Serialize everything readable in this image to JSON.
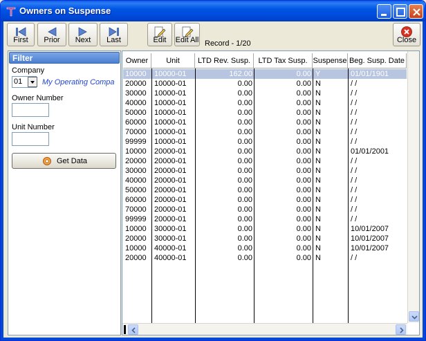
{
  "window": {
    "title": "Owners on Suspense"
  },
  "toolbar": {
    "first": "First",
    "prior": "Prior",
    "next": "Next",
    "last": "Last",
    "edit": "Edit",
    "edit_all": "Edit All",
    "close": "Close",
    "record": "Record - 1/20"
  },
  "filter": {
    "header": "Filter",
    "company_label": "Company",
    "company_value": "01",
    "company_name": "My Operating Compa",
    "owner_label": "Owner Number",
    "owner_value": "",
    "unit_label": "Unit Number",
    "unit_value": "",
    "get_data": "Get Data"
  },
  "grid": {
    "columns": [
      "Owner",
      "Unit",
      "LTD Rev. Susp.",
      "LTD Tax Susp.",
      "Suspense",
      "Beg. Susp. Date"
    ],
    "rows": [
      [
        "10000",
        "10000-01",
        "162.00",
        "0.00",
        "Y",
        "01/01/1901"
      ],
      [
        "20000",
        "10000-01",
        "0.00",
        "0.00",
        "N",
        "/ /"
      ],
      [
        "30000",
        "10000-01",
        "0.00",
        "0.00",
        "N",
        "/ /"
      ],
      [
        "40000",
        "10000-01",
        "0.00",
        "0.00",
        "N",
        "/ /"
      ],
      [
        "50000",
        "10000-01",
        "0.00",
        "0.00",
        "N",
        "/ /"
      ],
      [
        "60000",
        "10000-01",
        "0.00",
        "0.00",
        "N",
        "/ /"
      ],
      [
        "70000",
        "10000-01",
        "0.00",
        "0.00",
        "N",
        "/ /"
      ],
      [
        "99999",
        "10000-01",
        "0.00",
        "0.00",
        "N",
        "/ /"
      ],
      [
        "10000",
        "20000-01",
        "0.00",
        "0.00",
        "N",
        "01/01/2001"
      ],
      [
        "20000",
        "20000-01",
        "0.00",
        "0.00",
        "N",
        "/ /"
      ],
      [
        "30000",
        "20000-01",
        "0.00",
        "0.00",
        "N",
        "/ /"
      ],
      [
        "40000",
        "20000-01",
        "0.00",
        "0.00",
        "N",
        "/ /"
      ],
      [
        "50000",
        "20000-01",
        "0.00",
        "0.00",
        "N",
        "/ /"
      ],
      [
        "60000",
        "20000-01",
        "0.00",
        "0.00",
        "N",
        "/ /"
      ],
      [
        "70000",
        "20000-01",
        "0.00",
        "0.00",
        "N",
        "/ /"
      ],
      [
        "99999",
        "20000-01",
        "0.00",
        "0.00",
        "N",
        "/ /"
      ],
      [
        "10000",
        "30000-01",
        "0.00",
        "0.00",
        "N",
        "10/01/2007"
      ],
      [
        "20000",
        "30000-01",
        "0.00",
        "0.00",
        "N",
        "10/01/2007"
      ],
      [
        "10000",
        "40000-01",
        "0.00",
        "0.00",
        "N",
        "10/01/2007"
      ],
      [
        "20000",
        "40000-01",
        "0.00",
        "0.00",
        "N",
        "/ /"
      ]
    ],
    "selected_row": 0
  },
  "colors": {
    "titlebar": "#0055e5",
    "selection": "#b7c5e0",
    "company_text": "#2244cc"
  },
  "icons": {
    "app": "app-logo-icon",
    "first": "first-record-icon",
    "prior": "prior-record-icon",
    "next": "next-record-icon",
    "last": "last-record-icon",
    "edit": "edit-pencil-icon",
    "edit_all": "edit-all-pencil-icon",
    "close": "close-circle-icon",
    "get_data": "gear-icon"
  }
}
